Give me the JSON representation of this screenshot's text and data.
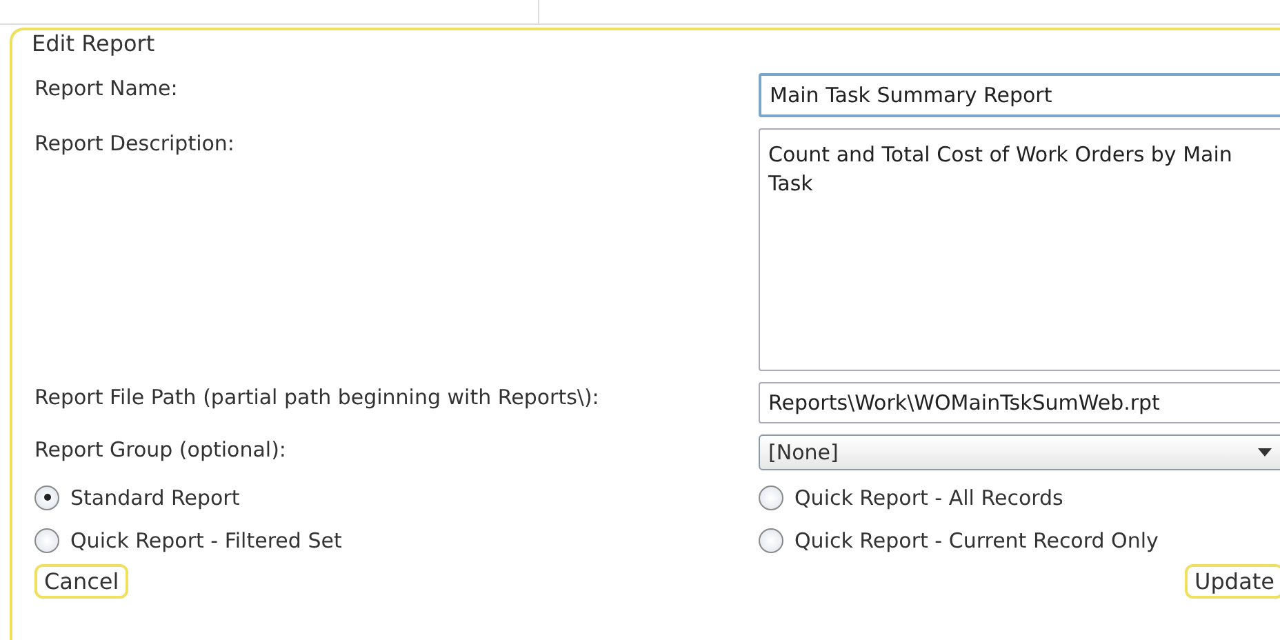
{
  "panel": {
    "title": "Edit Report"
  },
  "fields": [
    {
      "kind": "text",
      "label": "Report Name:",
      "value": "Main Task Summary Report"
    },
    {
      "kind": "textarea",
      "label": "Report Description:",
      "value": "Count and Total Cost of Work Orders by Main Task"
    },
    {
      "kind": "text",
      "label": "Report File Path (partial path beginning with Reports\\):",
      "value": "Reports\\Work\\WOMainTskSumWeb.rpt"
    },
    {
      "kind": "select",
      "label": "Report Group (optional):",
      "value": "[None]"
    }
  ],
  "report_types": [
    {
      "label": "Standard Report",
      "selected": true
    },
    {
      "label": "Quick Report - All Records",
      "selected": false
    },
    {
      "label": "Quick Report - Filtered Set",
      "selected": false
    },
    {
      "label": "Quick Report - Current Record Only",
      "selected": false
    }
  ],
  "buttons": [
    {
      "label": "Cancel"
    },
    {
      "label": "Update"
    }
  ]
}
